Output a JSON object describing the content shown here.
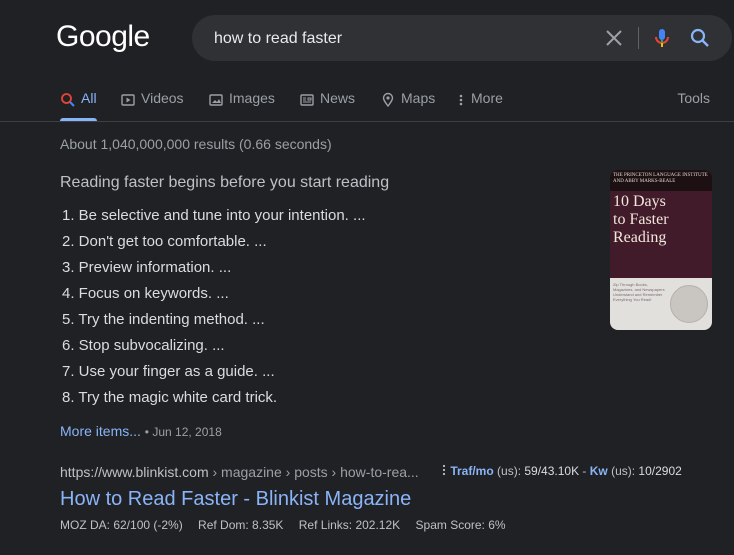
{
  "logo": "Google",
  "search": {
    "query": "how to read faster"
  },
  "tabs": [
    {
      "label": "All",
      "active": true
    },
    {
      "label": "Videos"
    },
    {
      "label": "Images"
    },
    {
      "label": "News"
    },
    {
      "label": "Maps"
    },
    {
      "label": "More"
    }
  ],
  "tools_label": "Tools",
  "stats": "About 1,040,000,000 results (0.66 seconds)",
  "snippet": {
    "title": "Reading faster begins before you start reading",
    "items": [
      "1. Be selective and tune into your intention. ...",
      "2. Don't get too comfortable. ...",
      "3. Preview information. ...",
      "4. Focus on keywords. ...",
      "5. Try the indenting method. ...",
      "6. Stop subvocalizing. ...",
      "7. Use your finger as a guide. ...",
      "8. Try the magic white card trick."
    ],
    "more_label": "More items...",
    "date": "Jun 12, 2018",
    "book": {
      "publisher": "THE PRINCETON LANGUAGE INSTITUTE AND ABBY MARKS-BEALE",
      "title_line1": "10 Days",
      "title_line2": "to Faster",
      "title_line3": "Reading",
      "blurb": "Zip Through Books, Magazines, and Newspapers Understand and Remember Everything You Read!"
    }
  },
  "result": {
    "url": "https://www.blinkist.com",
    "breadcrumb": " › magazine › posts › how-to-rea...",
    "title": "How to Read Faster - Blinkist Magazine",
    "seo": {
      "traf_label": "Traf/mo",
      "traf_region": " (us): ",
      "traf_value": "59/43.10K",
      "sep": " - ",
      "kw_label": "Kw",
      "kw_region": " (us): ",
      "kw_value": "10/2902"
    },
    "metrics": {
      "moz": "MOZ DA: 62/100 (-2%)",
      "ref_dom": "Ref Dom: 8.35K",
      "ref_links": "Ref Links: 202.12K",
      "spam": "Spam Score: 6%"
    }
  },
  "colors": {
    "background": "#202124",
    "link": "#8ab4f8",
    "searchbox": "#303134"
  }
}
